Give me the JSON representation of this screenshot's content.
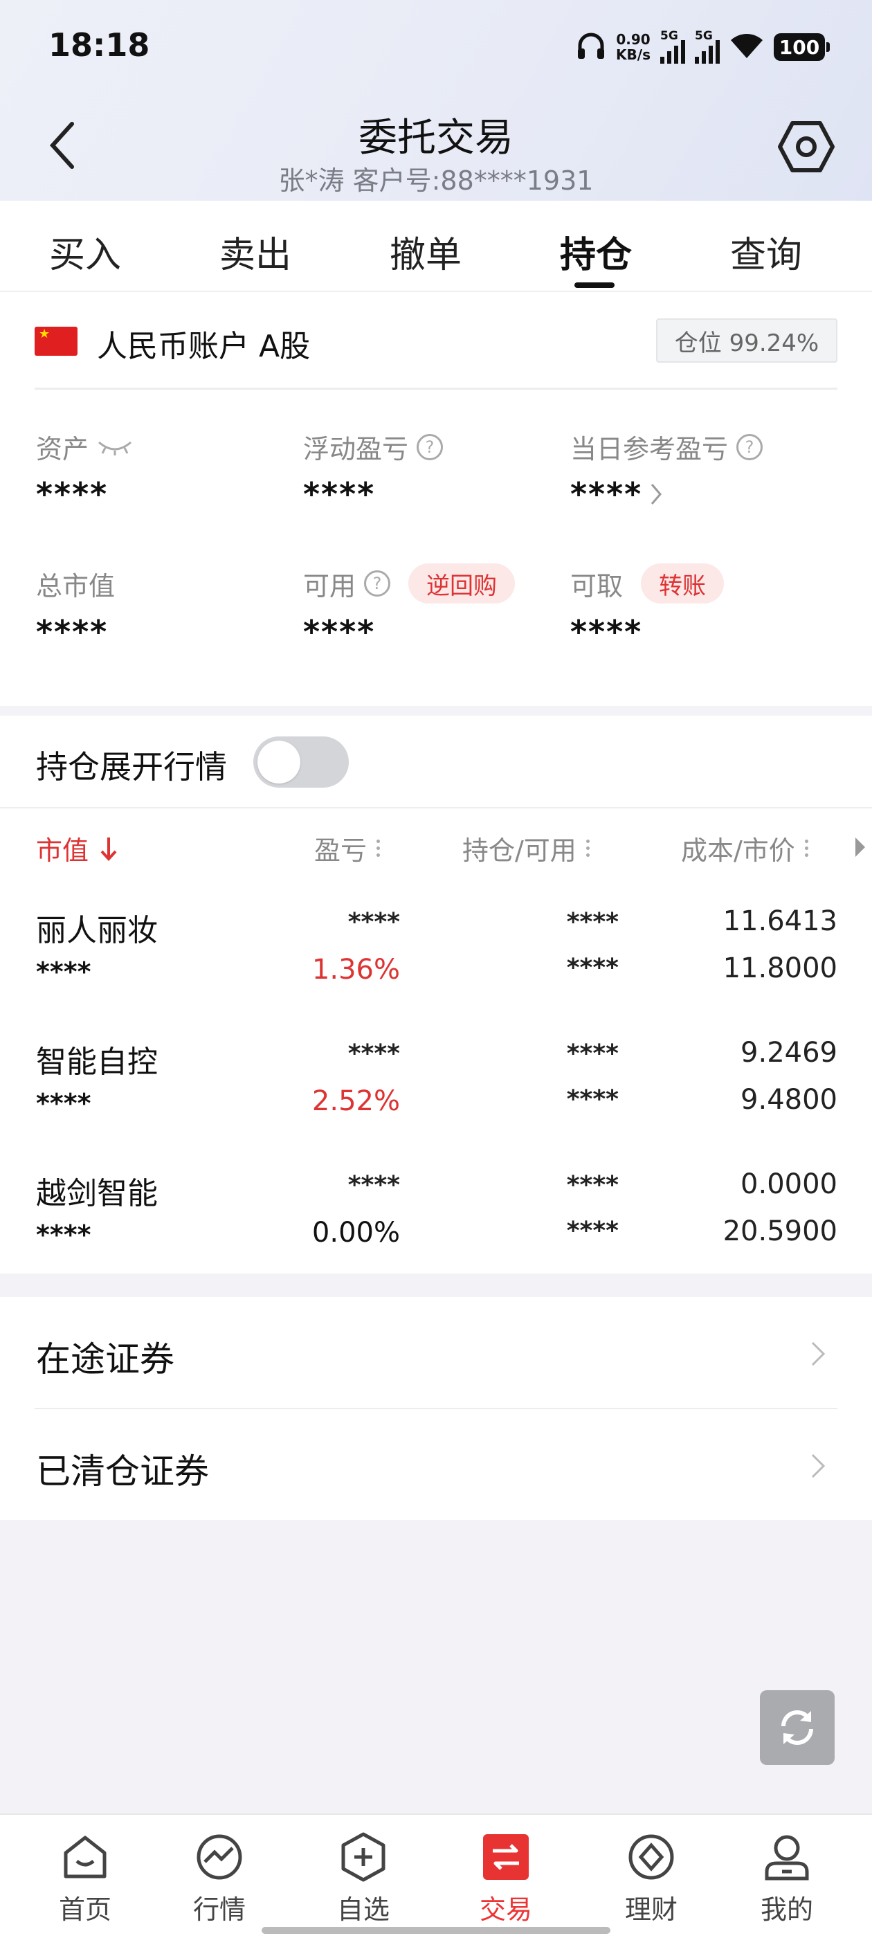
{
  "status": {
    "time": "18:18",
    "speed_value": "0.90",
    "speed_unit": "KB/s",
    "sim1": "5G",
    "sim2": "5G",
    "battery": "100"
  },
  "header": {
    "title": "委托交易",
    "subtitle": "张*涛 客户号:88****1931"
  },
  "tabs": [
    {
      "label": "买入"
    },
    {
      "label": "卖出"
    },
    {
      "label": "撤单"
    },
    {
      "label": "持仓"
    },
    {
      "label": "查询"
    }
  ],
  "active_tab": "持仓",
  "account": {
    "title": "人民币账户 A股",
    "flag_stars": "★",
    "position_badge": "仓位 99.24%",
    "fields": {
      "assets": {
        "label": "资产",
        "value": "****"
      },
      "floating_pl": {
        "label": "浮动盈亏",
        "value": "****"
      },
      "today_pl": {
        "label": "当日参考盈亏",
        "value": "****"
      },
      "market_value": {
        "label": "总市值",
        "value": "****"
      },
      "available": {
        "label": "可用",
        "value": "****",
        "action": "逆回购"
      },
      "withdrawable": {
        "label": "可取",
        "value": "****",
        "action": "转账"
      }
    },
    "help_glyph": "?"
  },
  "toggle_row": {
    "label": "持仓展开行情",
    "on": false
  },
  "holdings": {
    "headers": {
      "market_value": "市值",
      "pl": "盈亏",
      "position": "持仓/可用",
      "cost_price": "成本/市价"
    },
    "rows": [
      {
        "name": "丽人丽妆",
        "amount": "****",
        "pl": "****",
        "pl_pct": "1.36%",
        "position": "****",
        "available": "****",
        "cost": "11.6413",
        "price": "11.8000"
      },
      {
        "name": "智能自控",
        "amount": "****",
        "pl": "****",
        "pl_pct": "2.52%",
        "position": "****",
        "available": "****",
        "cost": "9.2469",
        "price": "9.4800"
      },
      {
        "name": "越剑智能",
        "amount": "****",
        "pl": "****",
        "pl_pct": "0.00%",
        "position": "****",
        "available": "****",
        "cost": "0.0000",
        "price": "20.5900"
      }
    ]
  },
  "links": [
    {
      "label": "在途证券"
    },
    {
      "label": "已清仓证券"
    }
  ],
  "bottom_nav": [
    {
      "label": "首页",
      "icon": "home-icon"
    },
    {
      "label": "行情",
      "icon": "chart-icon"
    },
    {
      "label": "自选",
      "icon": "add-hexagon-icon"
    },
    {
      "label": "交易",
      "icon": "exchange-icon"
    },
    {
      "label": "理财",
      "icon": "finance-icon"
    },
    {
      "label": "我的",
      "icon": "profile-icon"
    }
  ],
  "colors": {
    "accent_red": "#d33333",
    "tab_active": "#e33333",
    "background": "#f3f3f7"
  }
}
